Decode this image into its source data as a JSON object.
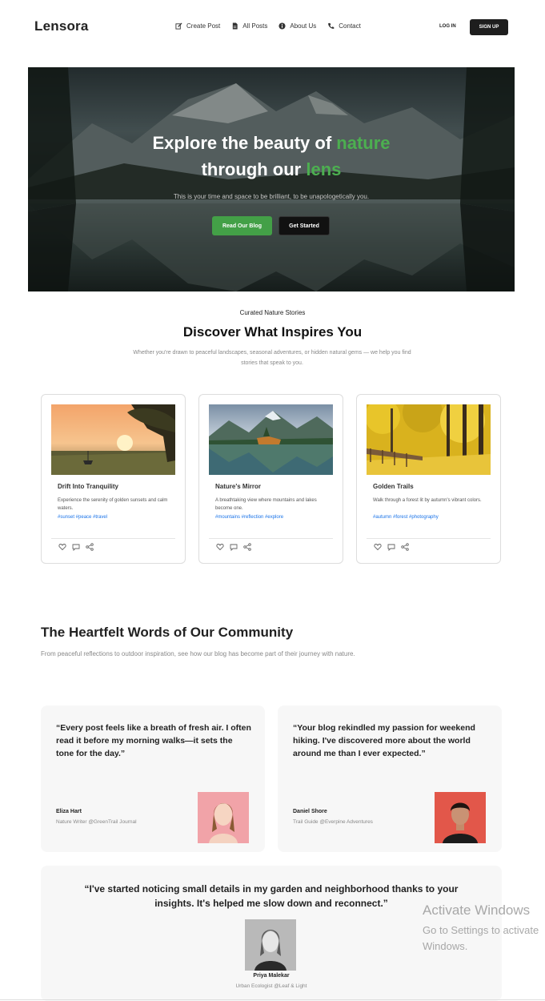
{
  "nav": {
    "logo": "Lensora",
    "links": [
      {
        "label": "Create Post",
        "icon": "edit-icon"
      },
      {
        "label": "All Posts",
        "icon": "document-icon"
      },
      {
        "label": "About Us",
        "icon": "info-icon"
      },
      {
        "label": "Contact",
        "icon": "phone-icon"
      }
    ],
    "login": "LOG IN",
    "signup": "SIGN UP"
  },
  "hero": {
    "title_part1": "Explore the beauty of ",
    "title_accent1": "nature",
    "title_part2": "through our ",
    "title_accent2": "lens",
    "subtitle": "This is your time and space to be brilliant, to be unapologetically you.",
    "btn_primary": "Read Our Blog",
    "btn_secondary": "Get Started",
    "accent_color": "#4caf50"
  },
  "discover": {
    "kicker": "Curated Nature Stories",
    "title": "Discover What Inspires You",
    "subtitle": "Whether you're drawn to peaceful landscapes, seasonal adventures, or hidden natural gems — we help you find stories that speak to you.",
    "cards": [
      {
        "title": "Drift Into Tranquility",
        "desc": "Experience the serenity of golden sunsets and calm waters.",
        "tags": "#sunset #peace #travel"
      },
      {
        "title": "Nature's Mirror",
        "desc": "A breathtaking view where mountains and lakes become one.",
        "tags": "#mountains #reflection #explore"
      },
      {
        "title": "Golden Trails",
        "desc": "Walk through a forest lit by autumn's vibrant colors.",
        "tags": "#autumn #forest #photography"
      }
    ]
  },
  "community": {
    "title": "The Heartfelt Words of Our Community",
    "subtitle": "From peaceful reflections to outdoor inspiration, see how our blog has become part of their journey with nature.",
    "testimonials": [
      {
        "quote": "“Every post feels like a breath of fresh air. I often read it before my morning walks—it sets the tone for the day.”",
        "name": "Eliza Hart",
        "role": "Nature Writer @GreenTrail Journal"
      },
      {
        "quote": "“Your blog rekindled my passion for weekend hiking. I've discovered more about the world around me than I ever expected.”",
        "name": "Daniel Shore",
        "role": "Trail Guide @Everpine Adventures"
      },
      {
        "quote": "“I've started noticing small details in my garden and neighborhood thanks to your insights. It's helped me slow down and reconnect.”",
        "name": "Priya Malekar",
        "role": "Urban Ecologist @Leaf & Light"
      }
    ]
  },
  "watermark": {
    "line1": "Activate Windows",
    "line2": "Go to Settings to activate",
    "line3": "Windows."
  }
}
